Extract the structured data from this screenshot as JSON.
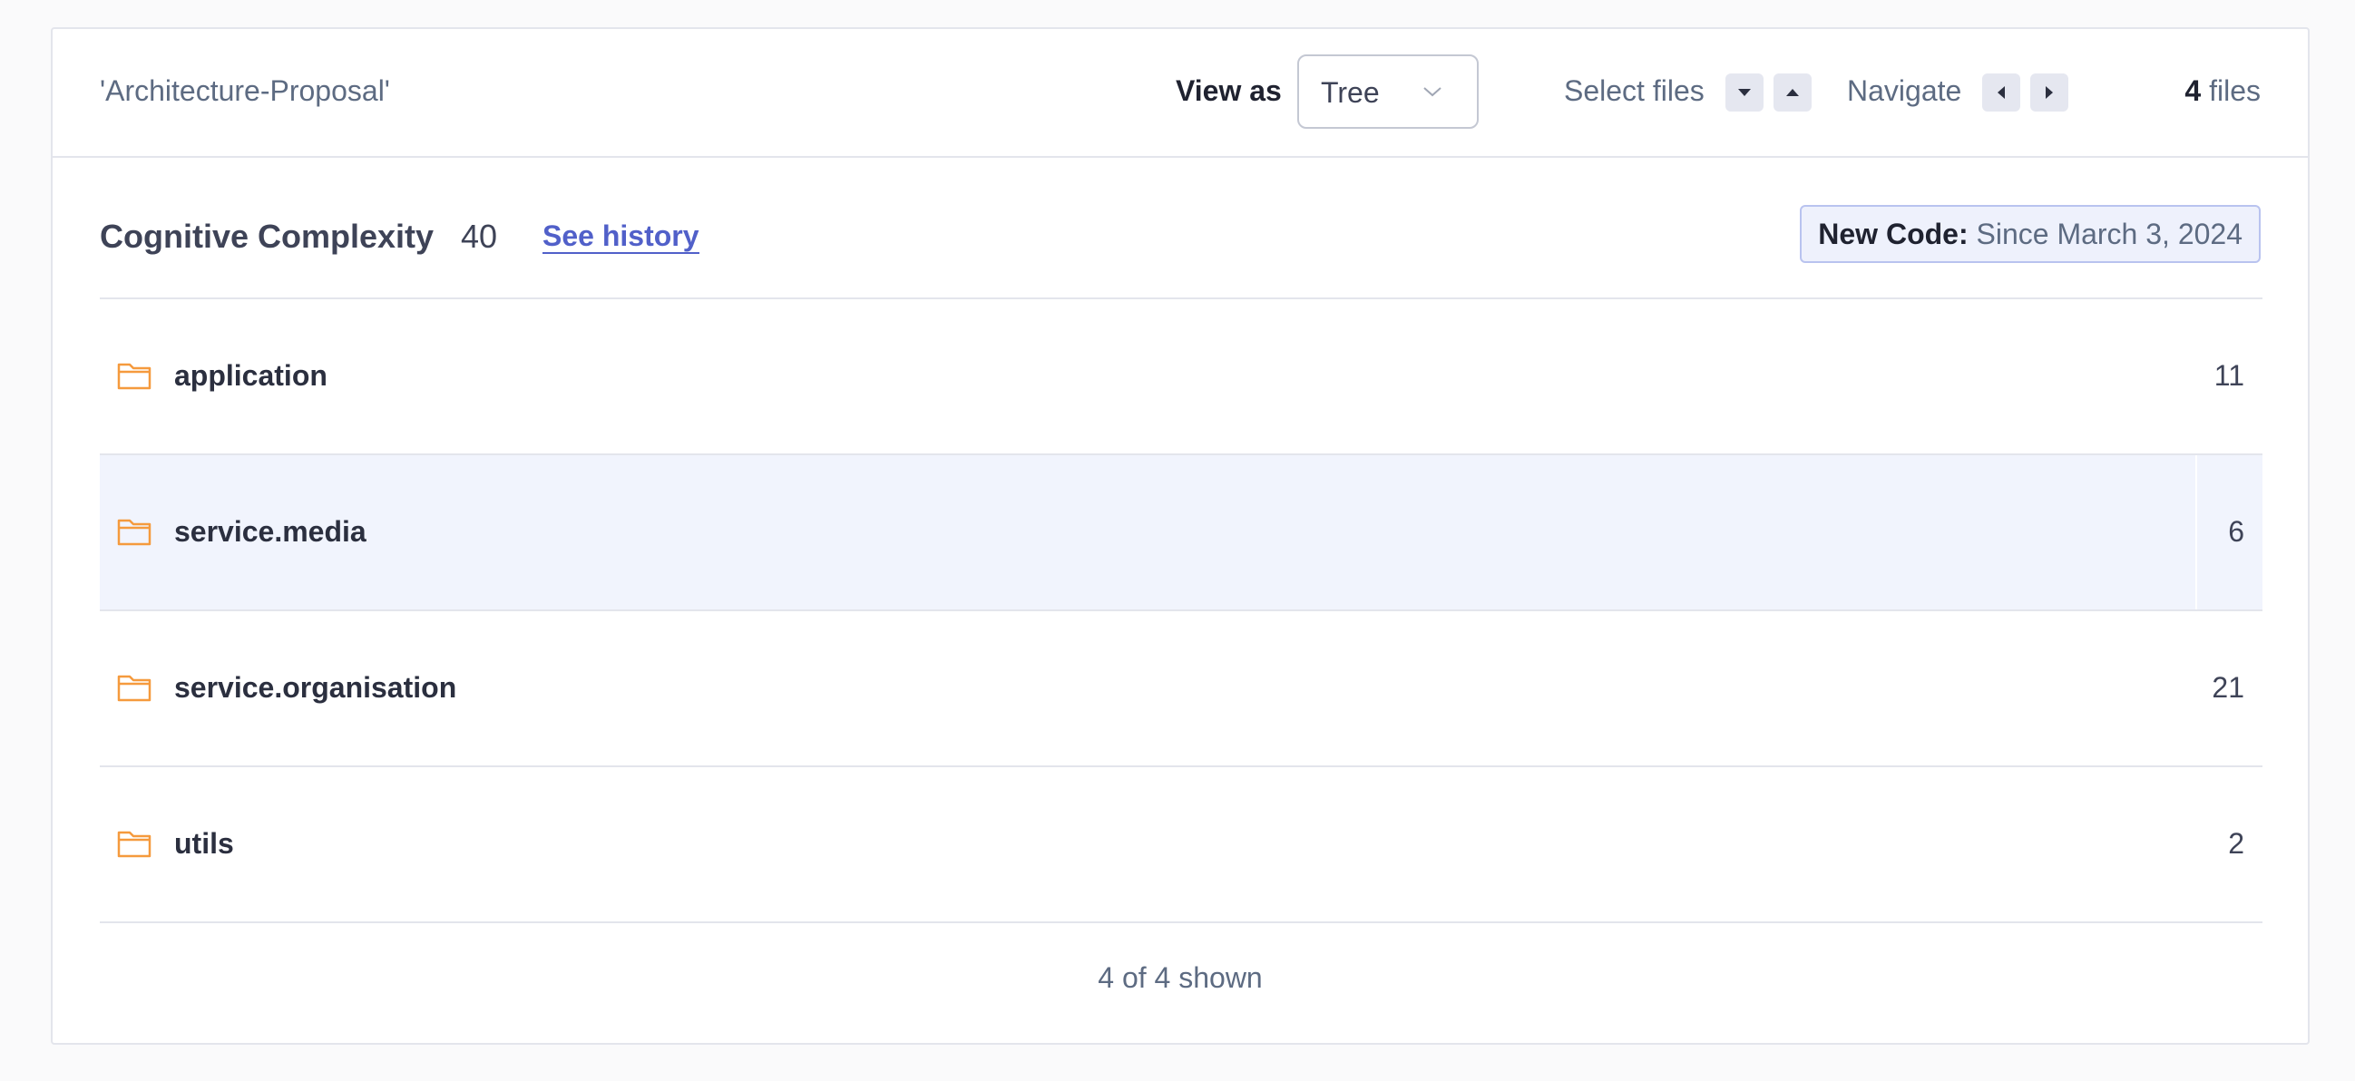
{
  "header": {
    "breadcrumb": "'Architecture-Proposal'",
    "view_as_label": "View as",
    "view_as_value": "Tree",
    "select_files_label": "Select files",
    "navigate_label": "Navigate",
    "files_count": "4",
    "files_suffix": "files"
  },
  "metric": {
    "title": "Cognitive Complexity",
    "value": "40",
    "history_link": "See history"
  },
  "new_code": {
    "label": "New Code:",
    "since": "Since March 3, 2024"
  },
  "rows": [
    {
      "name": "application",
      "value": "11",
      "icon": "folder-icon"
    },
    {
      "name": "service.media",
      "value": "6",
      "icon": "folder-icon",
      "highlighted": true
    },
    {
      "name": "service.organisation",
      "value": "21",
      "icon": "folder-icon"
    },
    {
      "name": "utils",
      "value": "2",
      "icon": "folder-icon"
    }
  ],
  "footer": {
    "shown_text": "4 of 4 shown"
  },
  "colors": {
    "accent": "#5160c9",
    "folder": "#f59a3d",
    "highlight_row": "#f1f4fd",
    "new_code_bg": "#eef1fc"
  }
}
